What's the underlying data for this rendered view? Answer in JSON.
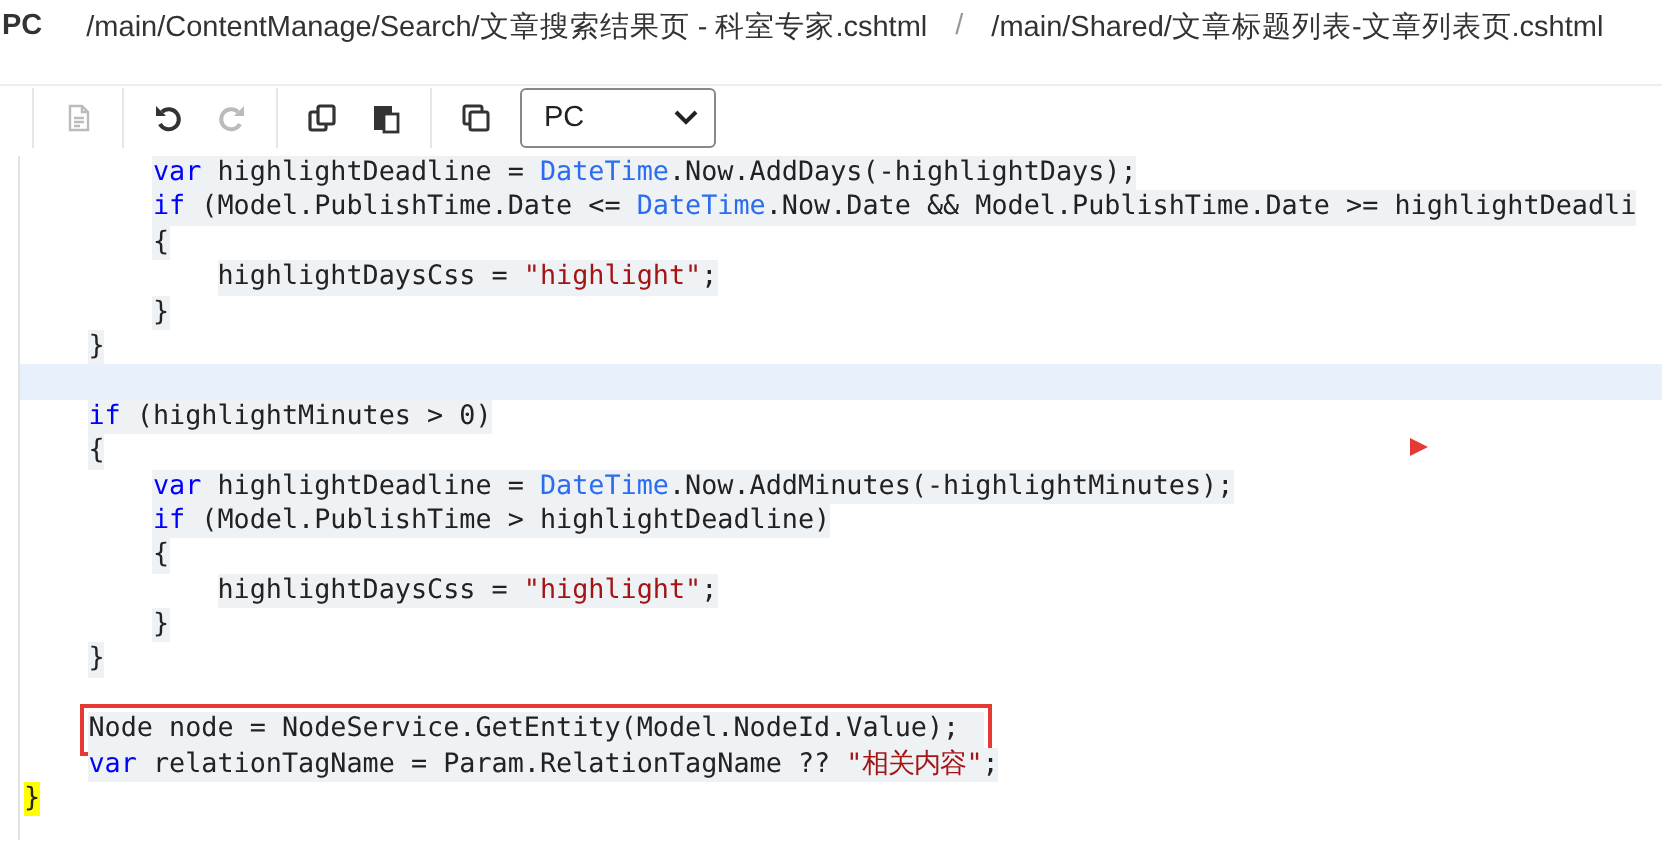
{
  "breadcrumb": {
    "root": "PC",
    "paths": [
      "/main/ContentManage/Search/文章搜索结果页 - 科室专家.cshtml",
      "/main/Shared/文章标题列表-文章列表页.cshtml"
    ],
    "separator": "/"
  },
  "toolbar": {
    "buttons": [
      {
        "kind": "document",
        "disabled": true
      },
      {
        "kind": "undo",
        "disabled": false
      },
      {
        "kind": "redo",
        "disabled": true
      },
      {
        "kind": "copy",
        "disabled": false
      },
      {
        "kind": "paste",
        "disabled": false
      },
      {
        "kind": "duplicate",
        "disabled": false
      }
    ],
    "select": {
      "value": "PC"
    }
  },
  "code": {
    "lines": [
      {
        "kind": "group",
        "children": [
          {
            "kind": "group",
            "children": [
              {
                "kind": "line",
                "tokens": [
                  {
                    "kind": "keyword",
                    "text": "var"
                  },
                  {
                    "kind": "plain",
                    "text": " highlightDeadline = "
                  },
                  {
                    "kind": "type",
                    "text": "DateTime"
                  },
                  {
                    "kind": "plain",
                    "text": ".Now.AddDays(-highlightDays);"
                  }
                ]
              },
              {
                "kind": "line",
                "tokens": [
                  {
                    "kind": "keyword",
                    "text": "if"
                  },
                  {
                    "kind": "plain",
                    "text": " (Model.PublishTime.Date <= "
                  },
                  {
                    "kind": "type",
                    "text": "DateTime"
                  },
                  {
                    "kind": "plain",
                    "text": ".Now.Date && Model.PublishTime.Date >= highlightDeadli"
                  }
                ]
              },
              {
                "kind": "line",
                "tokens": [
                  {
                    "kind": "plain",
                    "text": "{"
                  }
                ],
                "children": [
                  {
                    "kind": "line",
                    "tokens": [
                      {
                        "kind": "plain",
                        "text": "highlightDaysCss = "
                      },
                      {
                        "kind": "string",
                        "text": "\"highlight\""
                      },
                      {
                        "kind": "plain",
                        "text": ";"
                      }
                    ]
                  }
                ]
              },
              {
                "kind": "line",
                "tokens": [
                  {
                    "kind": "plain",
                    "text": "}"
                  }
                ]
              }
            ]
          },
          {
            "kind": "line",
            "tokens": [
              {
                "kind": "plain",
                "text": "}"
              }
            ]
          }
        ]
      },
      {
        "kind": "blank",
        "current": true
      },
      {
        "kind": "group",
        "children": [
          {
            "kind": "line",
            "tokens": [
              {
                "kind": "keyword",
                "text": "if"
              },
              {
                "kind": "plain",
                "text": " (highlightMinutes > 0)"
              }
            ]
          },
          {
            "kind": "line",
            "tokens": [
              {
                "kind": "plain",
                "text": "{"
              }
            ],
            "children": [
              {
                "kind": "line",
                "tokens": [
                  {
                    "kind": "keyword",
                    "text": "var"
                  },
                  {
                    "kind": "plain",
                    "text": " highlightDeadline = "
                  },
                  {
                    "kind": "type",
                    "text": "DateTime"
                  },
                  {
                    "kind": "plain",
                    "text": ".Now.AddMinutes(-highlightMinutes);"
                  }
                ]
              },
              {
                "kind": "line",
                "tokens": [
                  {
                    "kind": "keyword",
                    "text": "if"
                  },
                  {
                    "kind": "plain",
                    "text": " (Model.PublishTime > highlightDeadline)"
                  }
                ]
              },
              {
                "kind": "line",
                "tokens": [
                  {
                    "kind": "plain",
                    "text": "{"
                  }
                ],
                "children": [
                  {
                    "kind": "line",
                    "tokens": [
                      {
                        "kind": "plain",
                        "text": "highlightDaysCss = "
                      },
                      {
                        "kind": "string",
                        "text": "\"highlight\""
                      },
                      {
                        "kind": "plain",
                        "text": ";"
                      }
                    ]
                  }
                ]
              },
              {
                "kind": "line",
                "tokens": [
                  {
                    "kind": "plain",
                    "text": "}"
                  }
                ]
              }
            ]
          },
          {
            "kind": "line",
            "tokens": [
              {
                "kind": "plain",
                "text": "}"
              }
            ]
          }
        ]
      },
      {
        "kind": "blank"
      },
      {
        "kind": "group",
        "children": [
          {
            "kind": "line",
            "boxed": true,
            "tokens": [
              {
                "kind": "plain",
                "text": "Node node = NodeService.GetEntity(Model.NodeId.Value);"
              }
            ]
          },
          {
            "kind": "line",
            "boxed": false,
            "tokens": [
              {
                "kind": "keyword",
                "text": "var"
              },
              {
                "kind": "plain",
                "text": " relationTagName = Param.RelationTagName ?? "
              },
              {
                "kind": "string",
                "text": "\"相关内容\""
              },
              {
                "kind": "plain",
                "text": ";"
              }
            ]
          }
        ]
      },
      {
        "kind": "line",
        "matched_brace": true,
        "tokens": [
          {
            "kind": "plain",
            "text": "}"
          }
        ]
      }
    ]
  }
}
